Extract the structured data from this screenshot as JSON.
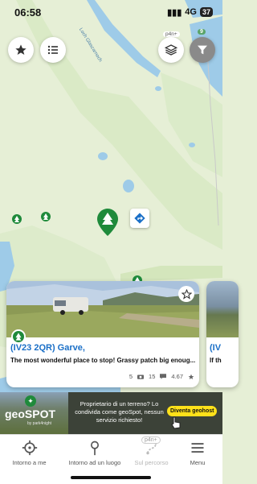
{
  "status_bar": {
    "time": "06:58",
    "network": "4G",
    "battery": "37"
  },
  "map": {
    "labels": {
      "loch_top": "Loch Glascarnoch",
      "p4n_plus_top": "p4n+",
      "pin_count": "9"
    }
  },
  "card": {
    "title": "(IV23 2QR) Garve,",
    "description": "The most wonderful place to stop! Grassy patch big enoug...",
    "photos": "5",
    "reviews": "15",
    "rating": "4.67"
  },
  "card_peek": {
    "title": "(IV",
    "description": "If th"
  },
  "banner": {
    "logo_text": "geoSPOT",
    "logo_sub": "by park4night",
    "message": "Proprietario di un terreno? Lo condivida come geoSpot, nessun servizio richiesto!",
    "cta": "Diventa geohost"
  },
  "tabbar": {
    "around_me": "Intorno a me",
    "around_place": "Intorno ad un luogo",
    "on_route": "Sul percorso",
    "on_route_badge": "p4n+",
    "menu": "Menu"
  },
  "colors": {
    "accent": "#1a6fc7",
    "pin_green": "#1f8a3b",
    "banner_cta": "#ffe11a",
    "water": "#9ecbe8",
    "land": "#e6efd6"
  }
}
